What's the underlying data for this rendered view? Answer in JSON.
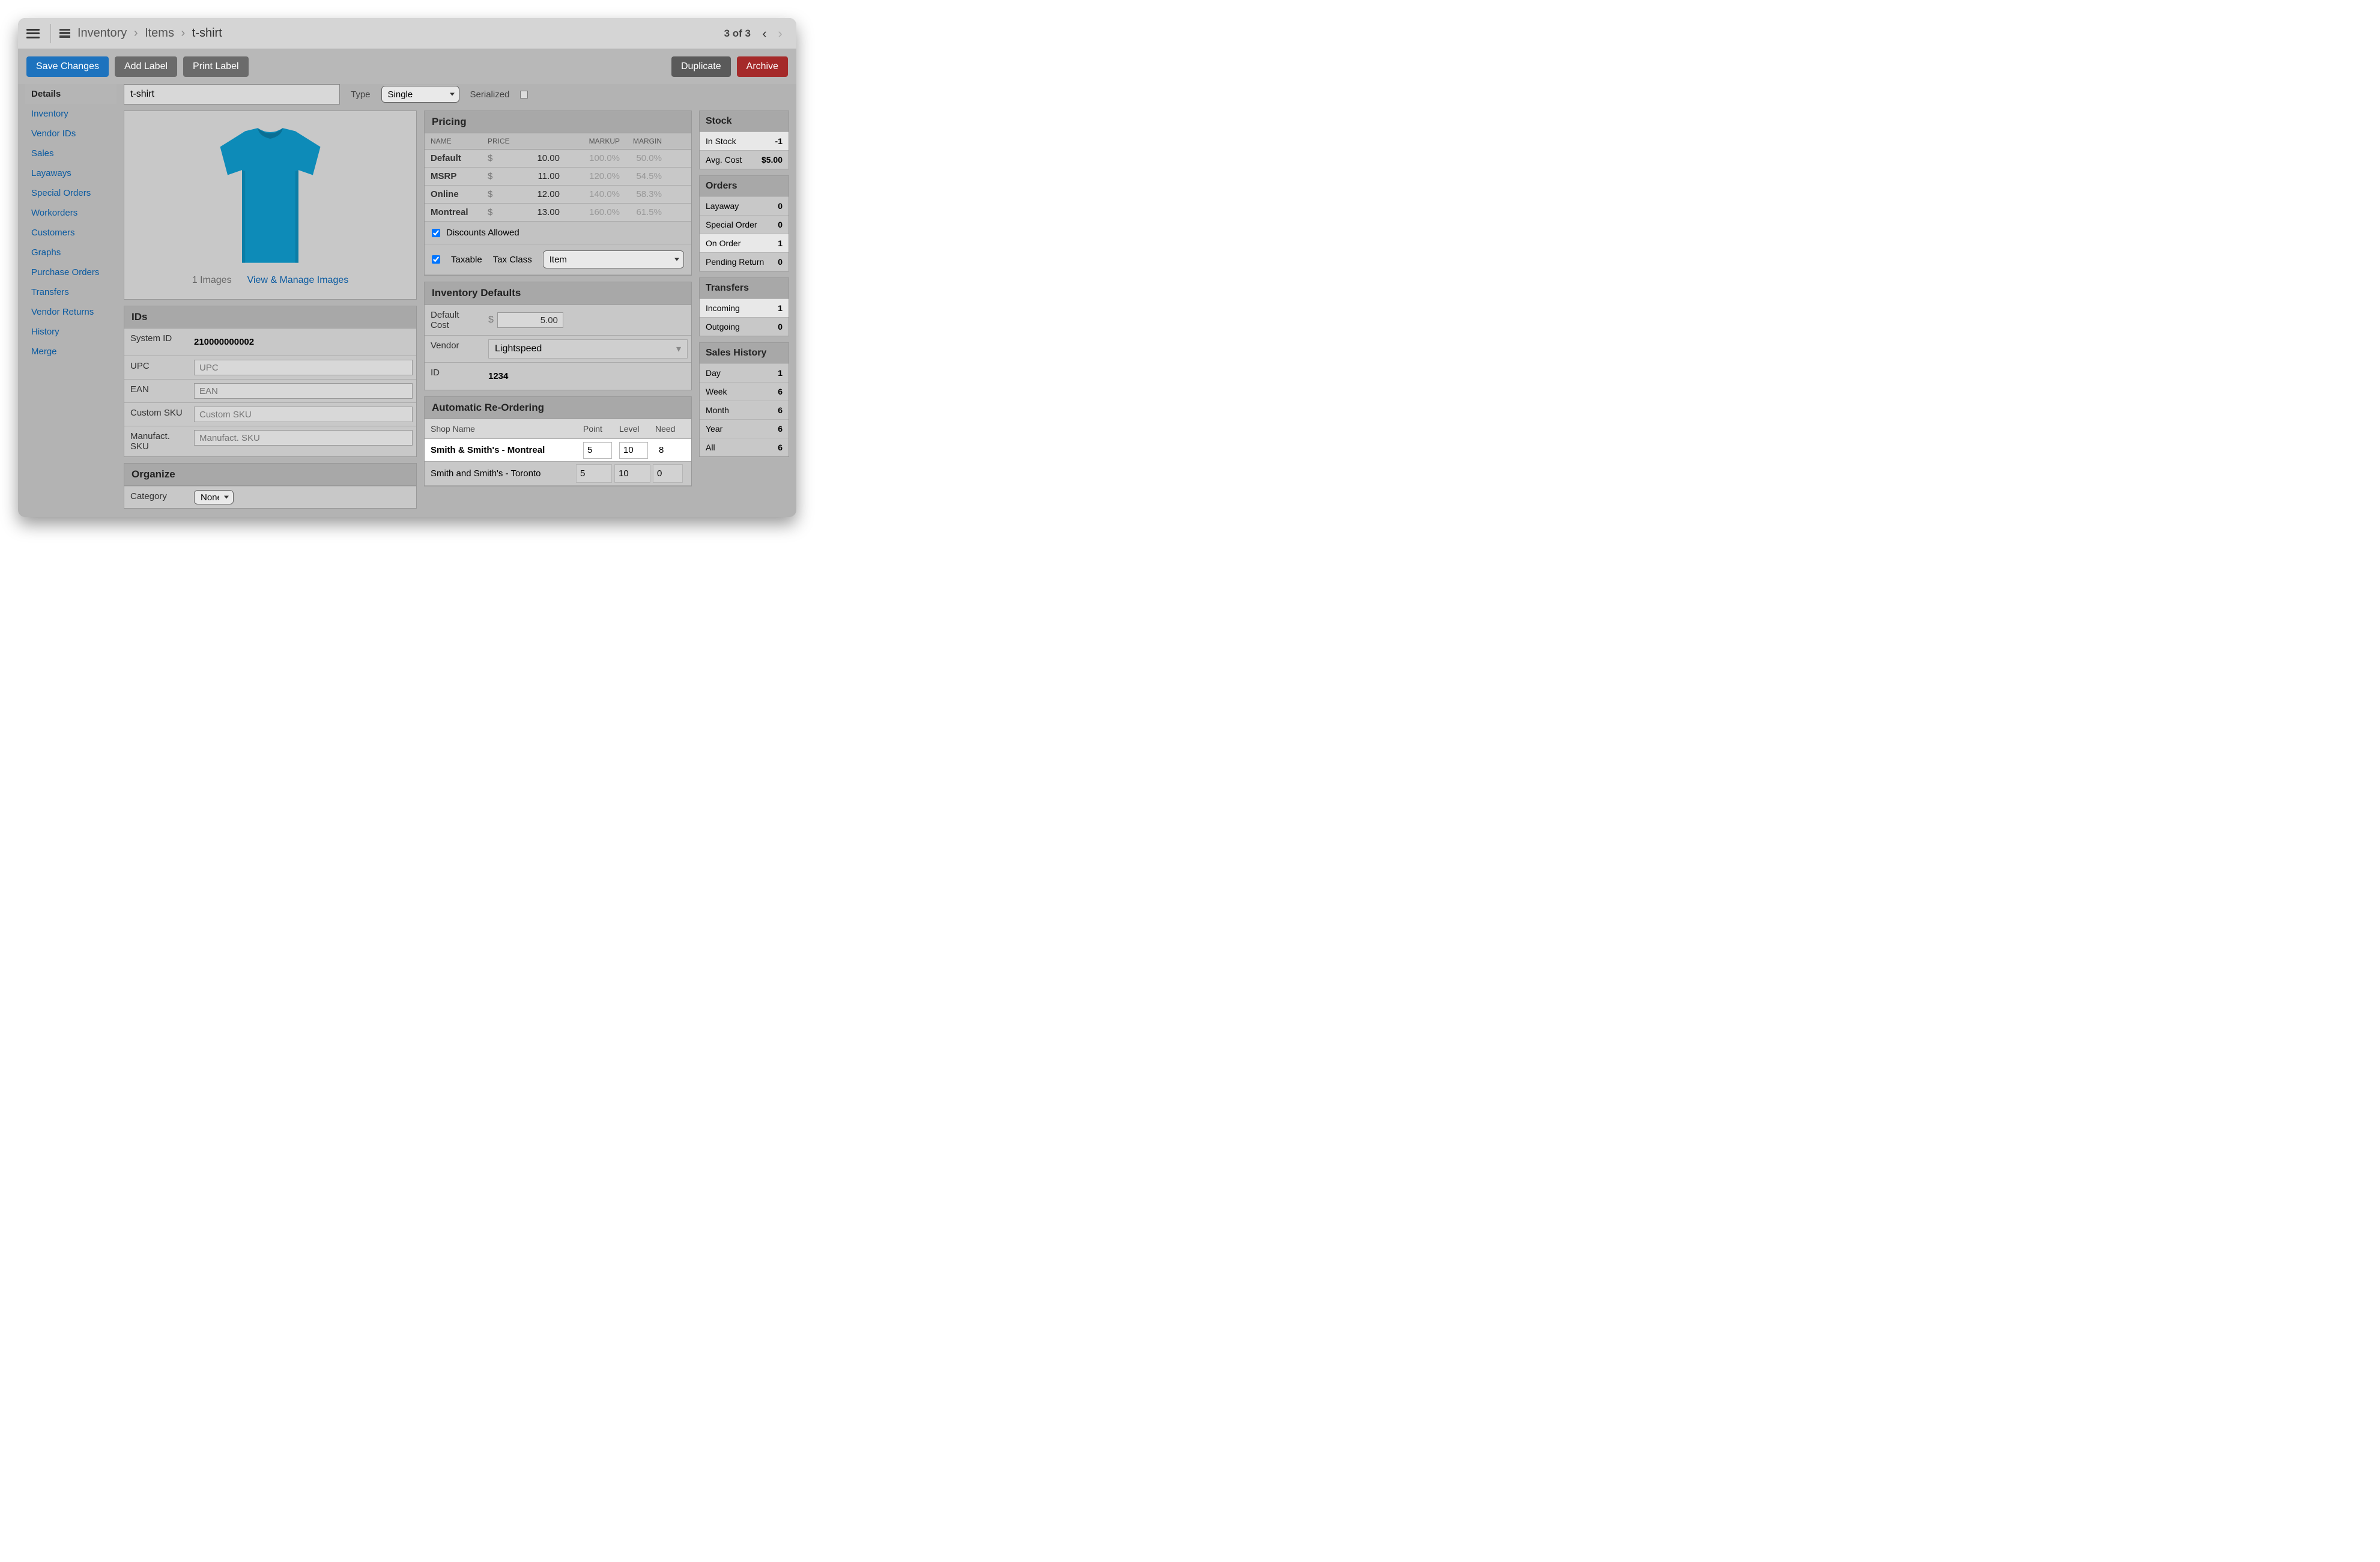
{
  "breadcrumb": {
    "root": "Inventory",
    "mid": "Items",
    "cur": "t-shirt"
  },
  "pager": {
    "text": "3 of 3"
  },
  "actions": {
    "save": "Save Changes",
    "addLabel": "Add Label",
    "printLabel": "Print Label",
    "duplicate": "Duplicate",
    "archive": "Archive"
  },
  "sidebar": [
    {
      "label": "Details",
      "active": true
    },
    {
      "label": "Inventory"
    },
    {
      "label": "Vendor IDs"
    },
    {
      "label": "Sales"
    },
    {
      "label": "Layaways"
    },
    {
      "label": "Special Orders"
    },
    {
      "label": "Workorders"
    },
    {
      "label": "Customers"
    },
    {
      "label": "Graphs"
    },
    {
      "label": "Purchase Orders"
    },
    {
      "label": "Transfers"
    },
    {
      "label": "Vendor Returns"
    },
    {
      "label": "History"
    },
    {
      "label": "Merge"
    }
  ],
  "itemName": "t-shirt",
  "typeLabel": "Type",
  "typeValue": "Single",
  "serializedLabel": "Serialized",
  "images": {
    "count": "1 Images",
    "link": "View & Manage Images"
  },
  "ids": {
    "title": "IDs",
    "rows": [
      {
        "k": "System ID",
        "static": "210000000002"
      },
      {
        "k": "UPC",
        "ph": "UPC"
      },
      {
        "k": "EAN",
        "ph": "EAN"
      },
      {
        "k": "Custom SKU",
        "ph": "Custom SKU"
      },
      {
        "k": "Manufact. SKU",
        "ph": "Manufact. SKU"
      }
    ]
  },
  "organize": {
    "title": "Organize",
    "categoryLabel": "Category",
    "categoryValue": "None"
  },
  "pricing": {
    "title": "Pricing",
    "cols": {
      "name": "NAME",
      "price": "PRICE",
      "markup": "MARKUP",
      "margin": "MARGIN"
    },
    "rows": [
      {
        "name": "Default",
        "cur": "$",
        "price": "10.00",
        "markup": "100.0%",
        "margin": "50.0%"
      },
      {
        "name": "MSRP",
        "cur": "$",
        "price": "11.00",
        "markup": "120.0%",
        "margin": "54.5%"
      },
      {
        "name": "Online",
        "cur": "$",
        "price": "12.00",
        "markup": "140.0%",
        "margin": "58.3%"
      },
      {
        "name": "Montreal",
        "cur": "$",
        "price": "13.00",
        "markup": "160.0%",
        "margin": "61.5%"
      }
    ],
    "discounts": "Discounts Allowed",
    "taxable": "Taxable",
    "taxClassLabel": "Tax Class",
    "taxClassValue": "Item"
  },
  "invDefaults": {
    "title": "Inventory Defaults",
    "defaultCost": {
      "label": "Default Cost",
      "cur": "$",
      "value": "5.00"
    },
    "vendor": {
      "label": "Vendor",
      "value": "Lightspeed"
    },
    "id": {
      "label": "ID",
      "value": "1234"
    }
  },
  "reorder": {
    "title": "Automatic Re-Ordering",
    "cols": {
      "shop": "Shop Name",
      "point": "Point",
      "level": "Level",
      "need": "Need"
    },
    "rows": [
      {
        "shop": "Smith & Smith's - Montreal",
        "point": "5",
        "level": "10",
        "need": "8",
        "editable": true
      },
      {
        "shop": "Smith and Smith's - Toronto",
        "point": "5",
        "level": "10",
        "need": "0",
        "editable": false
      }
    ]
  },
  "stock": {
    "title": "Stock",
    "rows": [
      {
        "k": "In Stock",
        "v": "-1",
        "hl": true
      },
      {
        "k": "Avg. Cost",
        "v": "$5.00"
      }
    ]
  },
  "orders": {
    "title": "Orders",
    "rows": [
      {
        "k": "Layaway",
        "v": "0"
      },
      {
        "k": "Special Order",
        "v": "0"
      },
      {
        "k": "On Order",
        "v": "1",
        "hl": true
      },
      {
        "k": "Pending Return",
        "v": "0"
      }
    ]
  },
  "transfers": {
    "title": "Transfers",
    "rows": [
      {
        "k": "Incoming",
        "v": "1",
        "hl": true
      },
      {
        "k": "Outgoing",
        "v": "0"
      }
    ]
  },
  "salesHistory": {
    "title": "Sales History",
    "rows": [
      {
        "k": "Day",
        "v": "1"
      },
      {
        "k": "Week",
        "v": "6"
      },
      {
        "k": "Month",
        "v": "6"
      },
      {
        "k": "Year",
        "v": "6"
      },
      {
        "k": "All",
        "v": "6"
      }
    ]
  }
}
